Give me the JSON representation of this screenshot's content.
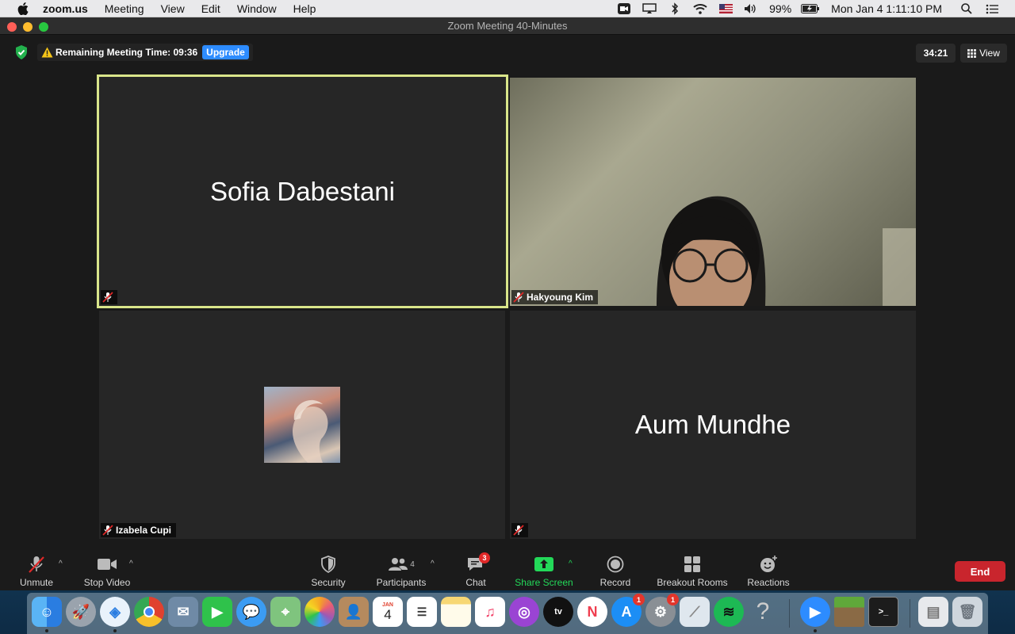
{
  "menubar": {
    "items": [
      "zoom.us",
      "Meeting",
      "View",
      "Edit",
      "Window",
      "Help"
    ],
    "battery": "99%",
    "clock": "Mon Jan 4  1:11:10 PM"
  },
  "window": {
    "title": "Zoom Meeting   40-Minutes"
  },
  "meeting": {
    "remaining_label": "Remaining Meeting Time: 09:36",
    "upgrade_label": "Upgrade",
    "elapsed": "34:21",
    "view_label": "View"
  },
  "participants": [
    {
      "name": "Sofia Dabestani",
      "muted": true,
      "active_speaker": true,
      "video": false
    },
    {
      "name": "Hakyoung Kim",
      "muted": true,
      "active_speaker": false,
      "video": true
    },
    {
      "name": "Izabela Cupi",
      "muted": true,
      "active_speaker": false,
      "video": false,
      "avatar": "profile-picture"
    },
    {
      "name": "Aum Mundhe",
      "muted": true,
      "active_speaker": false,
      "video": false
    }
  ],
  "toolbar": {
    "unmute": "Unmute",
    "stop_video": "Stop Video",
    "security": "Security",
    "participants": "Participants",
    "participants_count": "4",
    "chat": "Chat",
    "chat_badge": "3",
    "share_screen": "Share Screen",
    "record": "Record",
    "breakout_rooms": "Breakout Rooms",
    "reactions": "Reactions",
    "end": "End"
  },
  "dock": {
    "apps": [
      "finder-icon",
      "launchpad-icon",
      "safari-icon",
      "chrome-icon",
      "mail-bird-icon",
      "facetime-icon",
      "messages-icon",
      "maps-icon",
      "photos-icon",
      "contacts-icon",
      "calendar-icon",
      "reminders-icon",
      "notes-icon",
      "music-icon",
      "podcasts-icon",
      "appletv-icon",
      "news-icon",
      "appstore-icon",
      "system-preferences-icon",
      "preview-icon",
      "spotify-icon",
      "help-icon",
      "zoom-icon",
      "minecraft-icon",
      "terminal-icon",
      "documents-icon",
      "trash-icon"
    ],
    "calendar_month": "JAN",
    "calendar_day": "4",
    "appstore_badge": "1",
    "sysprefs_badge": "1"
  },
  "colors": {
    "active_speaker_border": "#d9e58a",
    "upgrade_blue": "#2d8cff",
    "end_red": "#c9252d",
    "share_green": "#23d959",
    "muted_red": "#e02828"
  }
}
